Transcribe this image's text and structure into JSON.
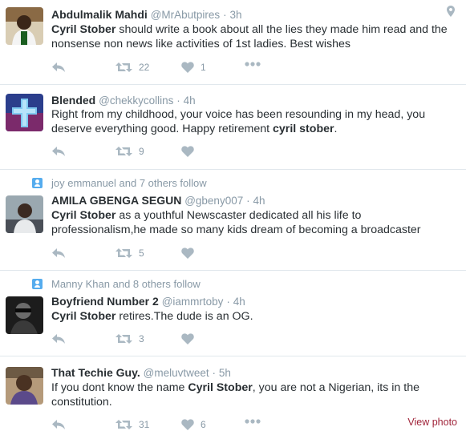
{
  "tweets": [
    {
      "name": "Abdulmalik Mahdi",
      "handle": "@MrAbutpires",
      "dot": "·",
      "time": "3h",
      "body": [
        {
          "t": "Cyril Stober",
          "b": true
        },
        {
          "t": " should write a book about all the lies they made him read and the nonsense non news like activities of 1st ladies. Best wishes",
          "b": false
        }
      ],
      "retweets": "22",
      "likes": "1",
      "icons": {
        "location": "location-pin-icon"
      }
    },
    {
      "name": "Blended",
      "handle": "@chekkycollins",
      "dot": "·",
      "time": "4h",
      "body": [
        {
          "t": "Right from my childhood, your voice has been resounding in my head, you deserve everything good. Happy retirement ",
          "b": false
        },
        {
          "t": "cyril stober",
          "b": true
        },
        {
          "t": ".",
          "b": false
        }
      ],
      "retweets": "9",
      "likes": ""
    },
    {
      "context": "joy emmanuel and 7 others follow",
      "name": "AMILA GBENGA SEGUN",
      "handle": "@gbeny007",
      "dot": "·",
      "time": "4h",
      "body": [
        {
          "t": "Cyril Stober",
          "b": true
        },
        {
          "t": " as a youthful Newscaster dedicated all his life to professionalism,he made so many kids dream of becoming a broadcaster",
          "b": false
        }
      ],
      "retweets": "5",
      "likes": ""
    },
    {
      "context": "Manny Khan and 8 others follow",
      "name": "Boyfriend Number 2",
      "handle": "@iammrtoby",
      "dot": "·",
      "time": "4h",
      "body": [
        {
          "t": "Cyril Stober",
          "b": true
        },
        {
          "t": " retires.The dude is an OG.",
          "b": false
        }
      ],
      "retweets": "3",
      "likes": ""
    },
    {
      "name": "That Techie Guy.",
      "handle": "@meluvtweet",
      "dot": "·",
      "time": "5h",
      "body": [
        {
          "t": "If you dont know the name ",
          "b": false
        },
        {
          "t": "Cyril Stober",
          "b": true
        },
        {
          "t": ", you are not a Nigerian, its in the constitution.",
          "b": false
        }
      ],
      "retweets": "31",
      "likes": "6",
      "view_photo": "View photo"
    }
  ],
  "colors": {
    "action_icon": "#aab8c2",
    "meta_text": "#8899a6",
    "follow_icon": "#55acee",
    "view_photo": "#a0243a",
    "divider": "#e1e8ed"
  },
  "action_icons": [
    "reply-icon",
    "retweet-icon",
    "like-heart-icon",
    "more-dots-icon"
  ]
}
